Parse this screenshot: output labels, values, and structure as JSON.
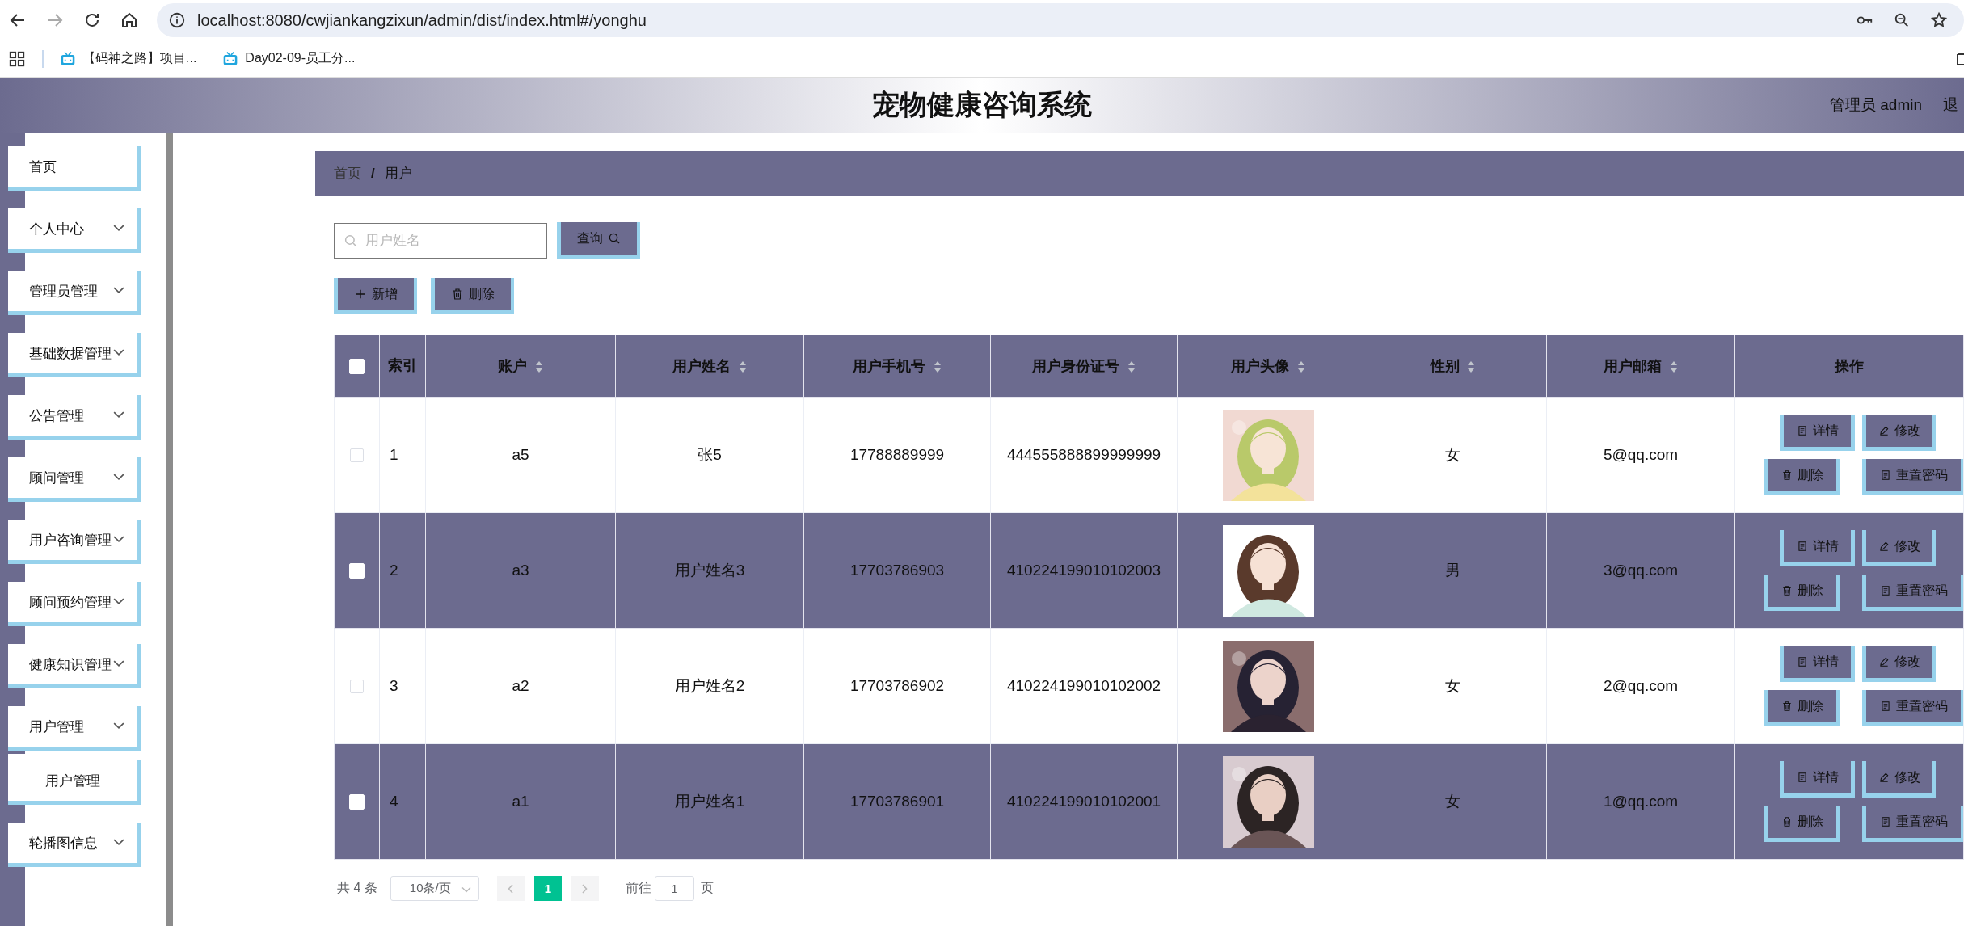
{
  "browser": {
    "url": "localhost:8080/cwjiankangzixun/admin/dist/index.html#/yonghu",
    "bookmarks": [
      {
        "label": "【码神之路】项目..."
      },
      {
        "label": "Day02-09-员工分..."
      }
    ]
  },
  "header": {
    "title": "宠物健康咨询系统",
    "user": "管理员 admin",
    "logout": "退"
  },
  "sidebar": {
    "items": [
      {
        "label": "首页",
        "kind": "link"
      },
      {
        "label": "个人中心",
        "kind": "submenu"
      },
      {
        "label": "管理员管理",
        "kind": "submenu"
      },
      {
        "label": "基础数据管理",
        "kind": "submenu"
      },
      {
        "label": "公告管理",
        "kind": "submenu"
      },
      {
        "label": "顾问管理",
        "kind": "submenu"
      },
      {
        "label": "用户咨询管理",
        "kind": "submenu"
      },
      {
        "label": "顾问预约管理",
        "kind": "submenu"
      },
      {
        "label": "健康知识管理",
        "kind": "submenu"
      },
      {
        "label": "用户管理",
        "kind": "submenu",
        "expanded": true,
        "children": [
          {
            "label": "用户管理"
          }
        ]
      },
      {
        "label": "轮播图信息",
        "kind": "submenu"
      }
    ]
  },
  "breadcrumb": {
    "separator": "/",
    "items": [
      "首页",
      "用户"
    ]
  },
  "search": {
    "placeholder": "用户姓名",
    "button": "查询"
  },
  "actions": [
    {
      "label": "新增",
      "kind": "add"
    },
    {
      "label": "删除",
      "kind": "delete"
    }
  ],
  "table": {
    "all_checked": false,
    "columns": [
      {
        "label": "索引",
        "sortable": false
      },
      {
        "label": "账户",
        "sortable": true
      },
      {
        "label": "用户姓名",
        "sortable": true
      },
      {
        "label": "用户手机号",
        "sortable": true
      },
      {
        "label": "用户身份证号",
        "sortable": true
      },
      {
        "label": "用户头像",
        "sortable": true
      },
      {
        "label": "性别",
        "sortable": true
      },
      {
        "label": "用户邮箱",
        "sortable": true
      },
      {
        "label": "操作",
        "sortable": false
      }
    ],
    "rows": [
      {
        "checked": false,
        "index": "1",
        "account": "a5",
        "name": "张5",
        "phone": "17788889999",
        "id_number": "444555888899999999",
        "gender": "女",
        "email": "5@qq.com",
        "actions": [
          {
            "label": "详情",
            "kind": "detail"
          },
          {
            "label": "修改",
            "kind": "edit"
          },
          {
            "label": "删除",
            "kind": "delete"
          },
          {
            "label": "重置密码",
            "kind": "detail"
          }
        ]
      },
      {
        "checked": false,
        "index": "2",
        "account": "a3",
        "name": "用户姓名3",
        "phone": "17703786903",
        "id_number": "410224199010102003",
        "gender": "男",
        "email": "3@qq.com",
        "actions": [
          {
            "label": "详情",
            "kind": "detail"
          },
          {
            "label": "修改",
            "kind": "edit"
          },
          {
            "label": "删除",
            "kind": "delete"
          },
          {
            "label": "重置密码",
            "kind": "detail"
          }
        ]
      },
      {
        "checked": false,
        "index": "3",
        "account": "a2",
        "name": "用户姓名2",
        "phone": "17703786902",
        "id_number": "410224199010102002",
        "gender": "女",
        "email": "2@qq.com",
        "actions": [
          {
            "label": "详情",
            "kind": "detail"
          },
          {
            "label": "修改",
            "kind": "edit"
          },
          {
            "label": "删除",
            "kind": "delete"
          },
          {
            "label": "重置密码",
            "kind": "detail"
          }
        ]
      },
      {
        "checked": false,
        "index": "4",
        "account": "a1",
        "name": "用户姓名1",
        "phone": "17703786901",
        "id_number": "410224199010102001",
        "gender": "女",
        "email": "1@qq.com",
        "actions": [
          {
            "label": "详情",
            "kind": "detail"
          },
          {
            "label": "修改",
            "kind": "edit"
          },
          {
            "label": "删除",
            "kind": "delete"
          },
          {
            "label": "重置密码",
            "kind": "detail"
          }
        ]
      }
    ]
  },
  "pagination": {
    "total": "共 4 条",
    "page_size": "10条/页",
    "pages": [
      {
        "label": "1",
        "selected": true
      }
    ],
    "goto_label": "前往",
    "goto_value": "1",
    "page_suffix": "页"
  }
}
